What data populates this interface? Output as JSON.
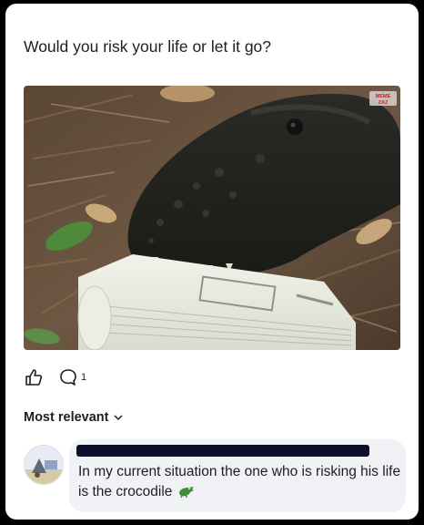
{
  "post": {
    "text": "Would you risk your life or let it go?",
    "image_alt": "Alligator holding a stack of dollar bills in its mouth",
    "watermark": "MEME ZAZ"
  },
  "actions": {
    "like_icon": "thumbs-up-icon",
    "comment_icon": "comment-icon",
    "comment_count": "1"
  },
  "comments": {
    "sort_label": "Most relevant",
    "sort_icon": "chevron-down-icon",
    "items": [
      {
        "text": "In my current situation the one who is risking his life is the crocodile",
        "emoji": "crocodile-emoji"
      }
    ]
  },
  "colors": {
    "card_bg": "#ffffff",
    "page_bg": "#000000",
    "text": "#1c1e21",
    "bubble_bg": "#f0f2f5",
    "redaction": "#0c0e2a"
  }
}
